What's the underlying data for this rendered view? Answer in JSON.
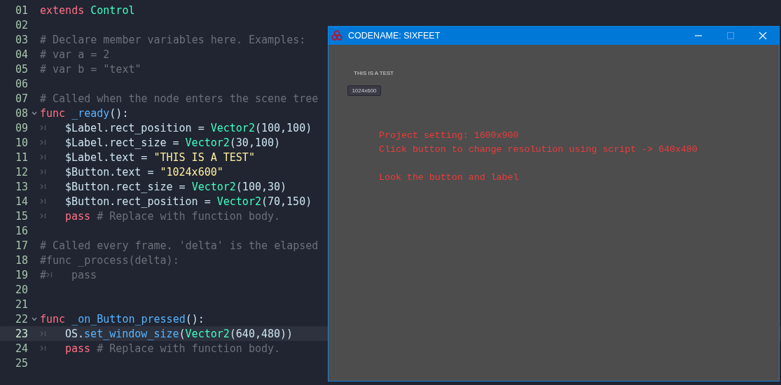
{
  "editor": {
    "lines": [
      {
        "number": "01",
        "current": false,
        "tokens": [
          {
            "kind": "keyword",
            "text": "extends "
          },
          {
            "kind": "class",
            "text": "Control"
          }
        ]
      },
      {
        "number": "02",
        "current": false
      },
      {
        "number": "03",
        "current": false,
        "tokens": [
          {
            "kind": "comment",
            "text": "# Declare member variables here. Examples:"
          }
        ]
      },
      {
        "number": "04",
        "current": false,
        "tokens": [
          {
            "kind": "comment",
            "text": "# var a = 2"
          }
        ]
      },
      {
        "number": "05",
        "current": false,
        "tokens": [
          {
            "kind": "comment",
            "text": "# var b = \"text\""
          }
        ]
      },
      {
        "number": "06",
        "current": false
      },
      {
        "number": "07",
        "current": false,
        "tokens": [
          {
            "kind": "comment",
            "text": "# Called when the node enters the scene tree"
          }
        ]
      },
      {
        "number": "08",
        "current": false,
        "fold": true,
        "tokens": [
          {
            "kind": "keyword",
            "text": "func "
          },
          {
            "kind": "function",
            "text": "_ready"
          },
          {
            "kind": "plain",
            "text": "():"
          }
        ]
      },
      {
        "number": "09",
        "current": false,
        "tokens": [
          {
            "kind": "tab"
          },
          {
            "kind": "plain",
            "text": "$Label.rect_position = "
          },
          {
            "kind": "class",
            "text": "Vector2"
          },
          {
            "kind": "plain",
            "text": "(100,100)"
          }
        ]
      },
      {
        "number": "10",
        "current": false,
        "tokens": [
          {
            "kind": "tab"
          },
          {
            "kind": "plain",
            "text": "$Label.rect_size = "
          },
          {
            "kind": "class",
            "text": "Vector2"
          },
          {
            "kind": "plain",
            "text": "(30,100)"
          }
        ]
      },
      {
        "number": "11",
        "current": false,
        "tokens": [
          {
            "kind": "tab"
          },
          {
            "kind": "plain",
            "text": "$Label.text = "
          },
          {
            "kind": "string",
            "text": "\"THIS IS A TEST\""
          }
        ]
      },
      {
        "number": "12",
        "current": false,
        "tokens": [
          {
            "kind": "tab"
          },
          {
            "kind": "plain",
            "text": "$Button.text = "
          },
          {
            "kind": "string",
            "text": "\"1024x600\""
          }
        ]
      },
      {
        "number": "13",
        "current": false,
        "tokens": [
          {
            "kind": "tab"
          },
          {
            "kind": "plain",
            "text": "$Button.rect_size = "
          },
          {
            "kind": "class",
            "text": "Vector2"
          },
          {
            "kind": "plain",
            "text": "(100,30)"
          }
        ]
      },
      {
        "number": "14",
        "current": false,
        "tokens": [
          {
            "kind": "tab"
          },
          {
            "kind": "plain",
            "text": "$Button.rect_position = "
          },
          {
            "kind": "class",
            "text": "Vector2"
          },
          {
            "kind": "plain",
            "text": "(70,150)"
          }
        ]
      },
      {
        "number": "15",
        "current": false,
        "tokens": [
          {
            "kind": "tab"
          },
          {
            "kind": "keyword",
            "text": "pass"
          },
          {
            "kind": "comment",
            "text": " # Replace with function body."
          }
        ]
      },
      {
        "number": "16",
        "current": false
      },
      {
        "number": "17",
        "current": false,
        "tokens": [
          {
            "kind": "comment",
            "text": "# Called every frame. 'delta' is the elapsed"
          }
        ]
      },
      {
        "number": "18",
        "current": false,
        "tokens": [
          {
            "kind": "comment",
            "text": "#func _process(delta):"
          }
        ]
      },
      {
        "number": "19",
        "current": false,
        "tokens": [
          {
            "kind": "comment",
            "text": "#"
          },
          {
            "kind": "tab"
          },
          {
            "kind": "comment",
            "text": "pass"
          }
        ]
      },
      {
        "number": "20",
        "current": false
      },
      {
        "number": "21",
        "current": false
      },
      {
        "number": "22",
        "current": false,
        "fold": true,
        "tokens": [
          {
            "kind": "keyword",
            "text": "func "
          },
          {
            "kind": "function",
            "text": "_on_Button_pressed"
          },
          {
            "kind": "plain",
            "text": "():"
          }
        ]
      },
      {
        "number": "23",
        "current": true,
        "tokens": [
          {
            "kind": "tab"
          },
          {
            "kind": "plain",
            "text": "OS."
          },
          {
            "kind": "function",
            "text": "set_window_size"
          },
          {
            "kind": "plain",
            "text": "("
          },
          {
            "kind": "class",
            "text": "Vector2"
          },
          {
            "kind": "plain",
            "text": "(640,480))"
          }
        ]
      },
      {
        "number": "24",
        "current": false,
        "tokens": [
          {
            "kind": "tab"
          },
          {
            "kind": "keyword",
            "text": "pass"
          },
          {
            "kind": "comment",
            "text": " # Replace with function body."
          }
        ]
      },
      {
        "number": "25",
        "current": false
      }
    ]
  },
  "game_window": {
    "title": "CODENAME: SIXFEET",
    "label": "THIS IS A TEST",
    "button": "1024x600",
    "notes": [
      [
        "Project setting: 1600x900",
        "Click button to change resolution using script -> 640x480"
      ],
      [
        "Look the button and label"
      ]
    ]
  }
}
